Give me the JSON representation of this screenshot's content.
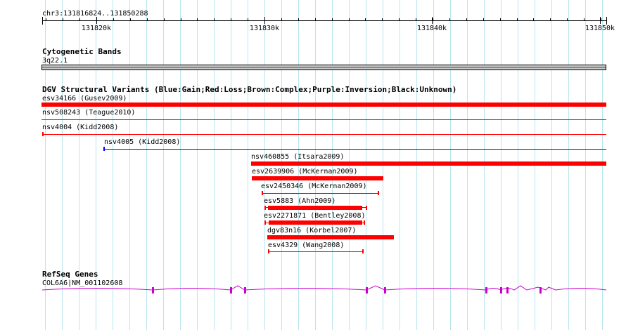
{
  "ruler": {
    "location": "chr3:131816824..131850288",
    "ticks": [
      "131820k",
      "131830k",
      "131840k",
      "131850k"
    ]
  },
  "cytogenetic": {
    "title": "Cytogenetic Bands",
    "band": "3q22.1"
  },
  "dgv": {
    "title": "DGV Structural Variants (Blue:Gain;Red:Loss;Brown:Complex;Purple:Inversion;Black:Unknown)",
    "variants": [
      {
        "label": "esv34166 (Gusev2009)",
        "color": "#ff0000",
        "style": "thick"
      },
      {
        "label": "nsv508243 (Teague2010)",
        "color": "#ff0000",
        "style": "thin"
      },
      {
        "label": "nsv4004 (Kidd2008)",
        "color": "#ff0000",
        "style": "thin-capped"
      },
      {
        "label": "nsv4005 (Kidd2008)",
        "color": "#0000ff",
        "style": "thin-capped"
      },
      {
        "label": "nsv460855 (Itsara2009)",
        "color": "#ff0000",
        "style": "thick"
      },
      {
        "label": "esv2639906 (McKernan2009)",
        "color": "#ff0000",
        "style": "thick"
      },
      {
        "label": "esv2450346 (McKernan2009)",
        "color": "#ff0000",
        "style": "thin-capped"
      },
      {
        "label": "esv5883 (Ahn2009)",
        "color": "#ff0000",
        "style": "thick-capped"
      },
      {
        "label": "esv2271871 (Bentley2008)",
        "color": "#ff0000",
        "style": "thick-capped"
      },
      {
        "label": "dgv83n16 (Korbel2007)",
        "color": "#ff0000",
        "style": "thick"
      },
      {
        "label": "esv4329 (Wang2008)",
        "color": "#ff0000",
        "style": "thin-capped"
      }
    ]
  },
  "refseq": {
    "title": "RefSeq Genes",
    "gene": "COL6A6|NM_001102608",
    "color": "#cc00cc"
  }
}
